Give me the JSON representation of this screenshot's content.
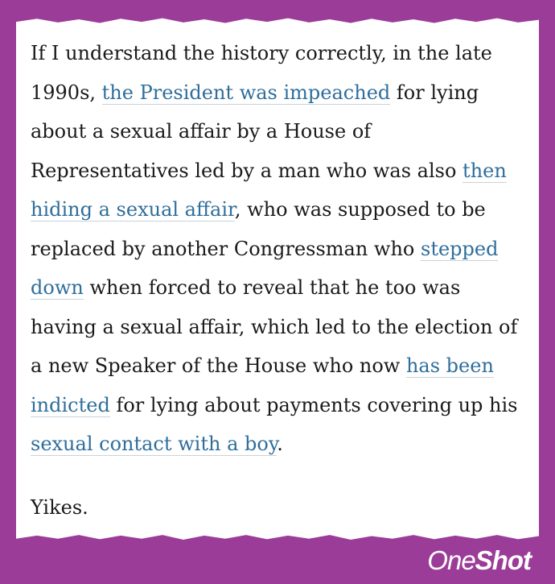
{
  "article": {
    "segments": [
      {
        "type": "text",
        "text": "If I understand the history correctly, in the late 1990s, "
      },
      {
        "type": "link",
        "text": "the President was impeached"
      },
      {
        "type": "text",
        "text": " for lying about a sexual affair by a House of Representatives led by a man who was also "
      },
      {
        "type": "link",
        "text": "then hiding a sexual affair"
      },
      {
        "type": "text",
        "text": ", who was supposed to be replaced by another Congressman who "
      },
      {
        "type": "link",
        "text": "stepped down"
      },
      {
        "type": "text",
        "text": " when forced to reveal that he too was having a sexual affair, which led to the election of a new Speaker of the House who now "
      },
      {
        "type": "link",
        "text": "has been indicted"
      },
      {
        "type": "text",
        "text": " for lying about payments covering up his "
      },
      {
        "type": "link",
        "text": "sexual contact with a boy"
      },
      {
        "type": "text",
        "text": "."
      }
    ],
    "closing": "Yikes."
  },
  "brand": {
    "light": "One",
    "bold": "Shot"
  },
  "colors": {
    "background": "#9b3d98",
    "paper": "#ffffff",
    "text": "#1a1a1a",
    "link": "#2f6e9b"
  }
}
